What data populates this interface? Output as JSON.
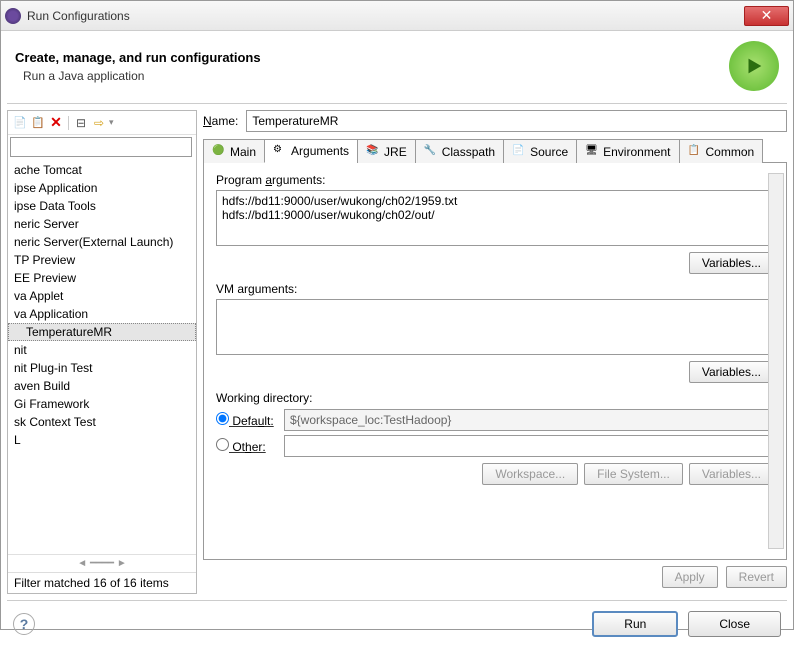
{
  "window": {
    "title": "Run Configurations"
  },
  "header": {
    "title": "Create, manage, and run configurations",
    "subtitle": "Run a Java application"
  },
  "left": {
    "filter_value": "",
    "items": [
      "ache Tomcat",
      "ipse Application",
      "ipse Data Tools",
      "neric Server",
      "neric Server(External Launch)",
      "TP Preview",
      "EE Preview",
      "va Applet",
      "va Application",
      "TemperatureMR",
      "nit",
      "nit Plug-in Test",
      "aven Build",
      "Gi Framework",
      "sk Context Test",
      "L"
    ],
    "selected_index": 9,
    "filter_status": "Filter matched 16 of 16 items"
  },
  "name": {
    "label": "Name:",
    "value": "TemperatureMR"
  },
  "tabs": [
    {
      "label": "Main",
      "icon": "main-icon"
    },
    {
      "label": "Arguments",
      "icon": "arguments-icon"
    },
    {
      "label": "JRE",
      "icon": "jre-icon"
    },
    {
      "label": "Classpath",
      "icon": "classpath-icon"
    },
    {
      "label": "Source",
      "icon": "source-icon"
    },
    {
      "label": "Environment",
      "icon": "environment-icon"
    },
    {
      "label": "Common",
      "icon": "common-icon"
    }
  ],
  "active_tab": 1,
  "arguments": {
    "program_label": "Program arguments:",
    "program_value": "hdfs://bd11:9000/user/wukong/ch02/1959.txt\nhdfs://bd11:9000/user/wukong/ch02/out/",
    "vm_label": "VM arguments:",
    "vm_value": "",
    "variables_btn": "Variables...",
    "working_dir_label": "Working directory:",
    "default_label": "Default:",
    "default_value": "${workspace_loc:TestHadoop}",
    "other_label": "Other:",
    "other_value": "",
    "workspace_btn": "Workspace...",
    "filesystem_btn": "File System...",
    "vars2_btn": "Variables..."
  },
  "apply_btn": "Apply",
  "revert_btn": "Revert",
  "footer": {
    "run": "Run",
    "close": "Close"
  }
}
